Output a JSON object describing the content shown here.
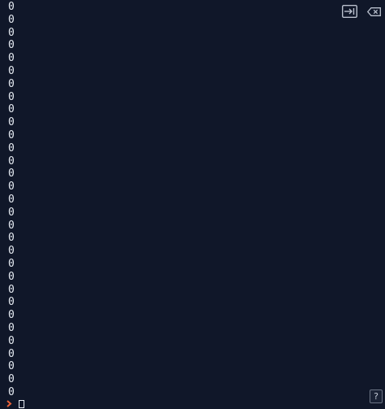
{
  "output_lines": [
    "0",
    "0",
    "0",
    "0",
    "0",
    "0",
    "0",
    "0",
    "0",
    "0",
    "0",
    "0",
    "0",
    "0",
    "0",
    "0",
    "0",
    "0",
    "0",
    "0",
    "0",
    "0",
    "0",
    "0",
    "0",
    "0",
    "0",
    "0",
    "0",
    "0",
    "0"
  ],
  "icons": {
    "exit": "sign-out-icon",
    "clear": "backspace-icon",
    "prompt": "chevron-right-icon"
  },
  "help_label": "?",
  "colors": {
    "background": "#101729",
    "text": "#e6ebf2",
    "prompt_accent": "#e8623a"
  }
}
